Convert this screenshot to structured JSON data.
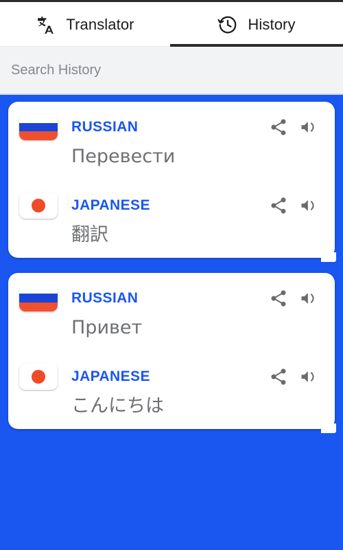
{
  "tabs": [
    {
      "label": "Translator",
      "icon": "translate-icon",
      "active": false
    },
    {
      "label": "History",
      "icon": "history-clock-icon",
      "active": true
    }
  ],
  "search": {
    "placeholder": "Search History",
    "value": ""
  },
  "colors": {
    "background_blue": "#1a56f0",
    "language_label": "#1a56f0",
    "phrase_text": "#6d6f72",
    "icon_gray": "#6b6b6b",
    "search_bg": "#f2f3f5"
  },
  "actions": {
    "share": "share-icon",
    "speak": "volume-up-icon"
  },
  "history": [
    {
      "entries": [
        {
          "language": "RUSSIAN",
          "flag": "flag-russia",
          "text": "Перевести"
        },
        {
          "language": "JAPANESE",
          "flag": "flag-japan",
          "text": "翻訳"
        }
      ]
    },
    {
      "entries": [
        {
          "language": "RUSSIAN",
          "flag": "flag-russia",
          "text": "Привет"
        },
        {
          "language": "JAPANESE",
          "flag": "flag-japan",
          "text": "こんにちは"
        }
      ]
    }
  ]
}
